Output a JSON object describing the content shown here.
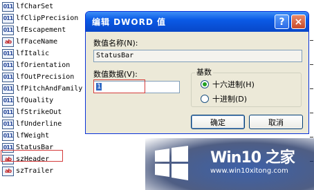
{
  "registry": {
    "items": [
      {
        "icon": "binary",
        "label": "lfCharSet"
      },
      {
        "icon": "binary",
        "label": "lfClipPrecision"
      },
      {
        "icon": "binary",
        "label": "lfEscapement"
      },
      {
        "icon": "string",
        "label": "lfFaceName"
      },
      {
        "icon": "binary",
        "label": "lfItalic"
      },
      {
        "icon": "binary",
        "label": "lfOrientation"
      },
      {
        "icon": "binary",
        "label": "lfOutPrecision"
      },
      {
        "icon": "binary",
        "label": "lfPitchAndFamily"
      },
      {
        "icon": "binary",
        "label": "lfQuality"
      },
      {
        "icon": "binary",
        "label": "lfStrikeOut"
      },
      {
        "icon": "binary",
        "label": "lfUnderline"
      },
      {
        "icon": "binary",
        "label": "lfWeight"
      },
      {
        "icon": "binary",
        "label": "StatusBar"
      },
      {
        "icon": "string",
        "label": "szHeader"
      },
      {
        "icon": "string",
        "label": "szTrailer"
      }
    ],
    "icon_glyphs": {
      "binary": "011",
      "string": "ab"
    }
  },
  "dialog": {
    "title": "编辑 DWORD 值",
    "help_label": "?",
    "close_label": "×",
    "name_label": "数值名称(N):",
    "name_value": "StatusBar",
    "data_label": "数值数据(V):",
    "data_value": "1",
    "base_label": "基数",
    "radios": [
      {
        "label": "十六进制(H)",
        "checked": true
      },
      {
        "label": "十进制(D)",
        "checked": false
      }
    ],
    "ok_label": "确定",
    "cancel_label": "取消"
  },
  "watermark": {
    "brand": "Win10 之家",
    "url": "www.win10xitong.com"
  },
  "colors": {
    "title_bar": "#0a5ae6",
    "highlight_box": "#d43a3a",
    "radio_checked": "#21a121"
  }
}
